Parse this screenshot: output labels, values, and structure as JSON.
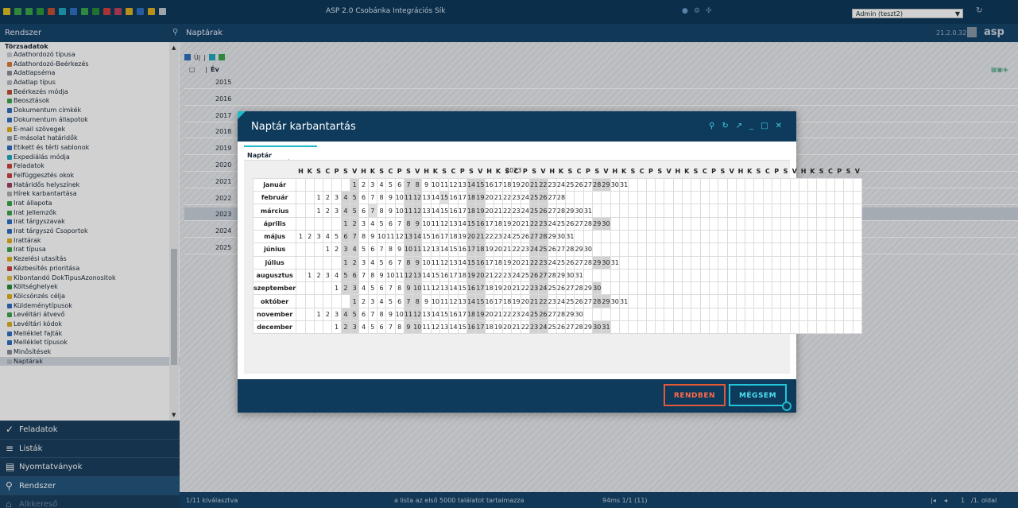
{
  "app": {
    "title": "ASP 2.0 Csobánka Integrációs Sík",
    "user": "Admin (teszt2)",
    "version": "21.2.0.32",
    "logo": "asp"
  },
  "subbar": {
    "section": "Rendszer",
    "page_title": "Naptárak"
  },
  "sidebar": {
    "group": "Törzsadatok",
    "items": [
      {
        "label": "Adathordozó típusa",
        "color": "#c9cfd6"
      },
      {
        "label": "Adathordozó-Beérkezés",
        "color": "#d97a3a"
      },
      {
        "label": "Adatlapséma",
        "color": "#8a9099"
      },
      {
        "label": "Adatlap típus",
        "color": "#b8bec5"
      },
      {
        "label": "Beérkezés módja",
        "color": "#c0503a"
      },
      {
        "label": "Beosztások",
        "color": "#3aa64a"
      },
      {
        "label": "Dokumentum címkék",
        "color": "#2f6fc0"
      },
      {
        "label": "Dokumentum állapotok",
        "color": "#2f6fc0"
      },
      {
        "label": "E-mail szövegek",
        "color": "#e0b020"
      },
      {
        "label": "E-másolat határidők",
        "color": "#9aa0a8"
      },
      {
        "label": "Etikett és térti sablonok",
        "color": "#2f6fc0"
      },
      {
        "label": "Expediálás módja",
        "color": "#21a8c0"
      },
      {
        "label": "Feladatok",
        "color": "#d04040"
      },
      {
        "label": "Felfüggesztés okok",
        "color": "#d04040"
      },
      {
        "label": "Határidős helyszínek",
        "color": "#a04060"
      },
      {
        "label": "Hírek karbantartása",
        "color": "#b0b0b0"
      },
      {
        "label": "Irat állapota",
        "color": "#3aa64a"
      },
      {
        "label": "Irat jellemzők",
        "color": "#3aa64a"
      },
      {
        "label": "Irat tárgyszavak",
        "color": "#2f6fc0"
      },
      {
        "label": "Irat tárgyszó Csoportok",
        "color": "#2f6fc0"
      },
      {
        "label": "Irattárak",
        "color": "#e0b020"
      },
      {
        "label": "Irat típusa",
        "color": "#3aa64a"
      },
      {
        "label": "Kezelési utasítás",
        "color": "#e0b020"
      },
      {
        "label": "Kézbesítés prioritása",
        "color": "#d04040"
      },
      {
        "label": "Kibontandó DokTipusAzonositok",
        "color": "#e0c040"
      },
      {
        "label": "Költséghelyek",
        "color": "#2a8a3a"
      },
      {
        "label": "Kölcsönzés célja",
        "color": "#e0b020"
      },
      {
        "label": "Küldeménytípusok",
        "color": "#2f6fc0"
      },
      {
        "label": "Levéltári átvevő",
        "color": "#3aa64a"
      },
      {
        "label": "Levéltári kódok",
        "color": "#e0b020"
      },
      {
        "label": "Melléklet fajták",
        "color": "#2f6fc0"
      },
      {
        "label": "Melléklet típusok",
        "color": "#2f6fc0"
      },
      {
        "label": "Minősítések",
        "color": "#8a9099"
      },
      {
        "label": "Naptárak",
        "color": "#b8bec5"
      }
    ]
  },
  "nav": [
    {
      "label": "Feladatok",
      "icon": "✓"
    },
    {
      "label": "Listák",
      "icon": "≡"
    },
    {
      "label": "Nyomtatványok",
      "icon": "▤"
    },
    {
      "label": "Rendszer",
      "icon": "⚲"
    },
    {
      "label": "Alkkereső",
      "icon": "⌂"
    }
  ],
  "main": {
    "toolbar_new": "Új",
    "col_year": "Év",
    "years": [
      "2015",
      "2016",
      "2017",
      "2018",
      "2019",
      "2020",
      "2021",
      "2022",
      "2023",
      "2024",
      "2025"
    ],
    "selected_year": "2023"
  },
  "status": {
    "selected": "1/11 kiválasztva",
    "limit": "a lista az első 5000 találatot tartalmazza",
    "timing": "94ms 1/1 (11)",
    "page_sep": "1",
    "page_info": "/1. oldal"
  },
  "dialog": {
    "title": "Naptár karbantartás",
    "tab": "Naptár karbantartás",
    "year": "2023",
    "ok": "RENDBEN",
    "cancel": "MÉGSEM",
    "ctrl_icons": [
      "pin-icon",
      "refresh-icon",
      "expand-icon",
      "minimize-icon",
      "maximize-icon",
      "close-icon"
    ],
    "day_headers": [
      "H",
      "K",
      "S",
      "C",
      "P",
      "S",
      "V",
      "H",
      "K",
      "S",
      "C",
      "P",
      "S",
      "V",
      "H",
      "K",
      "S",
      "C",
      "P",
      "S",
      "V",
      "H",
      "K",
      "S",
      "C",
      "P",
      "S",
      "V",
      "H",
      "K",
      "S",
      "C",
      "P",
      "S",
      "V",
      "H",
      "K",
      "S",
      "C",
      "P",
      "S",
      "V",
      "H",
      "K",
      "S",
      "C",
      "P",
      "S",
      "V",
      "H",
      "K",
      "S",
      "C",
      "P",
      "S",
      "V",
      "H",
      "K",
      "S",
      "C",
      "P",
      "S",
      "V"
    ],
    "months": [
      {
        "name": "január",
        "offset": 6,
        "days": 31
      },
      {
        "name": "február",
        "offset": 2,
        "days": 28
      },
      {
        "name": "március",
        "offset": 2,
        "days": 31
      },
      {
        "name": "április",
        "offset": 5,
        "days": 30
      },
      {
        "name": "május",
        "offset": 0,
        "days": 31
      },
      {
        "name": "június",
        "offset": 3,
        "days": 30
      },
      {
        "name": "július",
        "offset": 5,
        "days": 31
      },
      {
        "name": "augusztus",
        "offset": 1,
        "days": 31
      },
      {
        "name": "szeptember",
        "offset": 4,
        "days": 30
      },
      {
        "name": "október",
        "offset": 6,
        "days": 31
      },
      {
        "name": "november",
        "offset": 2,
        "days": 30
      },
      {
        "name": "december",
        "offset": 4,
        "days": 31
      }
    ],
    "extra_holidays": [
      {
        "month": 2,
        "day": 15
      },
      {
        "month": 3,
        "day": 7
      },
      {
        "month": 4,
        "day": 1
      },
      {
        "month": 4,
        "day": 29
      },
      {
        "month": 9,
        "day": 23
      },
      {
        "month": 10,
        "day": 1
      }
    ]
  }
}
